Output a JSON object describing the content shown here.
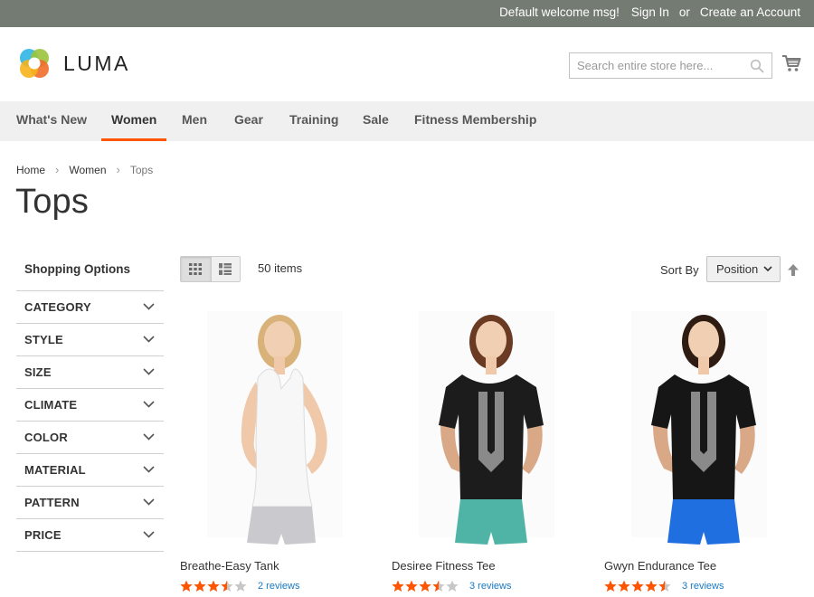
{
  "topbar": {
    "welcome": "Default welcome msg!",
    "sign_in": "Sign In",
    "or": "or",
    "create_account": "Create an Account"
  },
  "header": {
    "logo_text": "LUMA",
    "search_placeholder": "Search entire store here...",
    "search_value": ""
  },
  "nav": {
    "items": [
      {
        "label": "What's New",
        "active": false
      },
      {
        "label": "Women",
        "active": true
      },
      {
        "label": "Men",
        "active": false
      },
      {
        "label": "Gear",
        "active": false
      },
      {
        "label": "Training",
        "active": false
      },
      {
        "label": "Sale",
        "active": false
      },
      {
        "label": "Fitness Membership",
        "active": false
      }
    ]
  },
  "breadcrumb": {
    "items": [
      "Home",
      "Women",
      "Tops"
    ]
  },
  "page": {
    "title": "Tops"
  },
  "sidebar": {
    "heading": "Shopping Options",
    "filters": [
      "CATEGORY",
      "STYLE",
      "SIZE",
      "CLIMATE",
      "COLOR",
      "MATERIAL",
      "PATTERN",
      "PRICE"
    ]
  },
  "toolbar": {
    "view_modes": [
      "grid",
      "list"
    ],
    "active_mode": "grid",
    "amount": "50 items",
    "sort_label": "Sort By",
    "sort_value": "Position"
  },
  "products": [
    {
      "name": "Breathe-Easy Tank",
      "rating": 3.5,
      "reviews": "2 reviews",
      "shirt_color": "#f7f7f7",
      "shorts_color": "#c9c9ce",
      "hair_color": "#d9b27a"
    },
    {
      "name": "Desiree Fitness Tee",
      "rating": 3.5,
      "reviews": "3 reviews",
      "shirt_color": "#1c1c1c",
      "shorts_color": "#4fb3a6",
      "hair_color": "#6b3a22"
    },
    {
      "name": "Gwyn Endurance Tee",
      "rating": 4.5,
      "reviews": "3 reviews",
      "shirt_color": "#161616",
      "shorts_color": "#1f6fe0",
      "hair_color": "#2e1b12"
    }
  ],
  "colors": {
    "accent": "#ff5501",
    "star": "#ff5501",
    "link": "#1979c3",
    "topbar": "#747b73",
    "nav_bg": "#f0f0f0"
  },
  "icons": {
    "search": "magnifier-icon",
    "cart": "cart-icon",
    "grid": "grid-icon",
    "list": "list-icon",
    "sort_direction": "arrow-up-icon",
    "filter_toggle": "chevron-down-icon"
  }
}
